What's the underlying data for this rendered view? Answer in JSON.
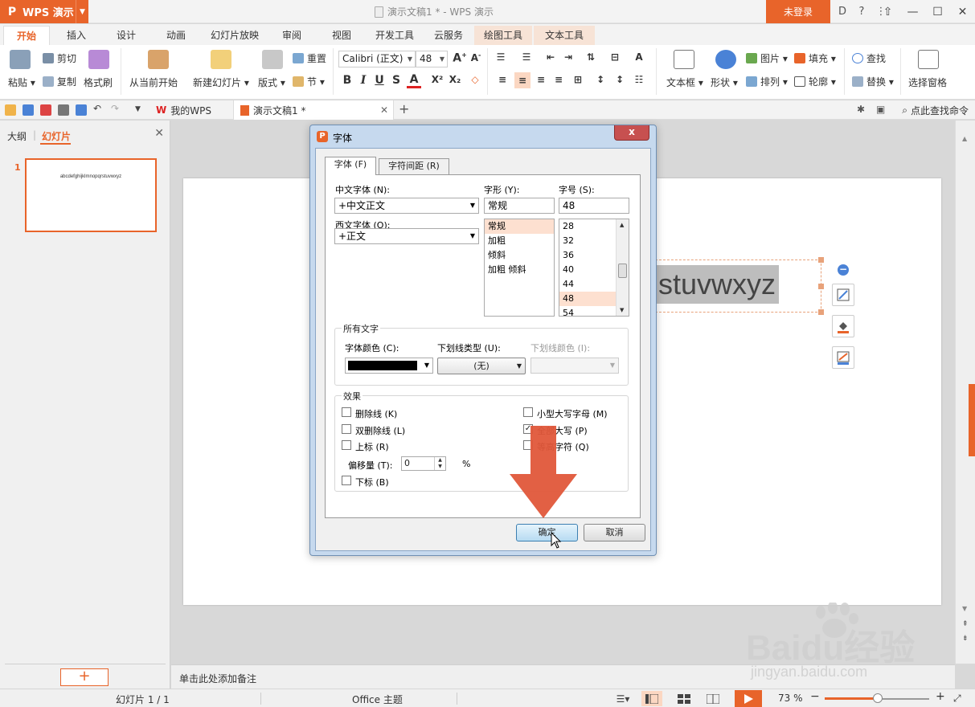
{
  "window": {
    "app_name": "WPS 演示",
    "title": "演示文稿1 * - WPS 演示",
    "login": "未登录",
    "accent": "#e8642a"
  },
  "menu_tabs": [
    "开始",
    "插入",
    "设计",
    "动画",
    "幻灯片放映",
    "审阅",
    "视图",
    "开发工具",
    "云服务",
    "绘图工具",
    "文本工具"
  ],
  "ribbon": {
    "paste": "粘贴",
    "cut": "剪切",
    "copy": "复制",
    "format_painter": "格式刷",
    "from_current": "从当前开始",
    "new_slide": "新建幻灯片",
    "layout": "版式",
    "reset": "重置",
    "section": "节",
    "font_name": "Calibri (正文)",
    "font_size": "48",
    "textbox": "文本框",
    "shape": "形状",
    "picture": "图片",
    "fill": "填充",
    "arrange": "排列",
    "outline": "轮廓",
    "find": "查找",
    "replace": "替换",
    "selection_pane": "选择窗格"
  },
  "doc_tabs": {
    "my_wps": "我的WPS",
    "current": "演示文稿1 *",
    "find_command": "点此查找命令"
  },
  "left_panel": {
    "tab_outline": "大纲",
    "tab_slides": "幻灯片",
    "slide_number": "1",
    "thumb_text": "abcdefghijklmnopqrstuvwxyz"
  },
  "slide": {
    "visible_text": "stuvwxyz"
  },
  "notes_placeholder": "单击此处添加备注",
  "status": {
    "slide_pos": "幻灯片 1 / 1",
    "theme": "Office 主题",
    "zoom": "73 %",
    "zoom_level": 0.73
  },
  "dialog": {
    "title": "字体",
    "close": "x",
    "tab_font": "字体 (F)",
    "tab_spacing": "字符间距 (R)",
    "chinese_font_label": "中文字体 (N):",
    "chinese_font_value": "+中文正文",
    "western_font_label": "西文字体 (O):",
    "western_font_value": "+正文",
    "style_label": "字形 (Y):",
    "style_value": "常规",
    "styles": [
      "常规",
      "加粗",
      "倾斜",
      "加粗  倾斜"
    ],
    "size_label": "字号 (S):",
    "size_value": "48",
    "sizes": [
      "28",
      "32",
      "36",
      "40",
      "44",
      "48",
      "54"
    ],
    "all_text": "所有文字",
    "font_color_label": "字体颜色 (C):",
    "underline_type_label": "下划线类型 (U):",
    "underline_type_value": "(无)",
    "underline_color_label": "下划线颜色 (I):",
    "effects": "效果",
    "strikethrough": "删除线 (K)",
    "double_strike": "双删除线 (L)",
    "superscript": "上标 (R)",
    "offset_label": "偏移量 (T):",
    "offset_value": "0",
    "percent": "%",
    "subscript": "下标 (B)",
    "small_caps": "小型大写字母 (M)",
    "all_caps": "全部大写 (P)",
    "equalize": "等高字符 (Q)",
    "ok": "确定",
    "cancel": "取消"
  },
  "watermark": {
    "brand": "Baidu经验",
    "url": "jingyan.baidu.com"
  }
}
